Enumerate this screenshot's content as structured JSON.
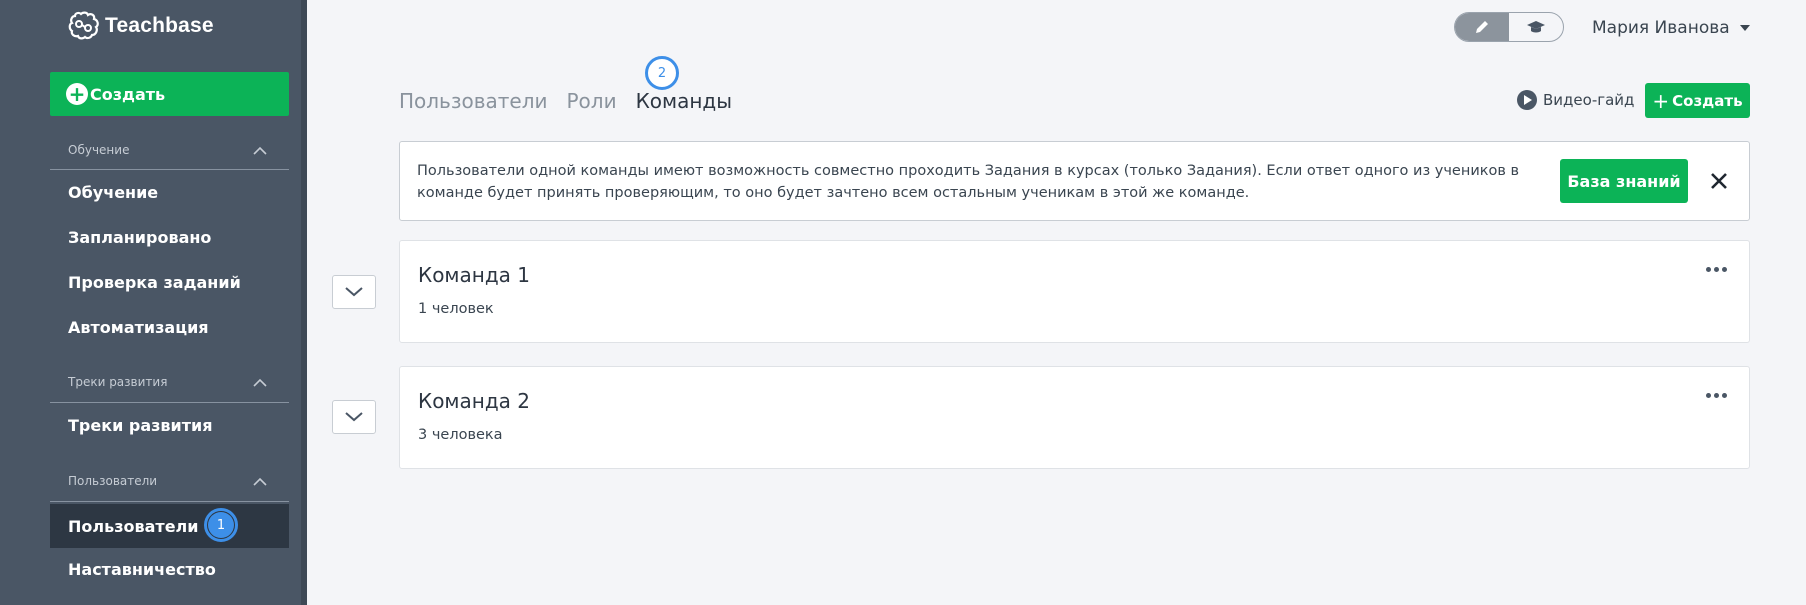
{
  "sidebar": {
    "logo_text": "Teachbase",
    "create_label": "Создать",
    "sections": [
      {
        "title": "Обучение",
        "items": [
          "Обучение",
          "Запланировано",
          "Проверка заданий",
          "Автоматизация"
        ]
      },
      {
        "title": "Треки развития",
        "items": [
          "Треки развития"
        ]
      },
      {
        "title": "Пользователи",
        "items": [
          "Пользователи",
          "Наставничество"
        ]
      }
    ],
    "active_item": "Пользователи",
    "badge_1": "1"
  },
  "header": {
    "user_name": "Мария Иванова"
  },
  "tabs": [
    "Пользователи",
    "Роли",
    "Команды"
  ],
  "active_tab": "Команды",
  "badge_2": "2",
  "toolbar": {
    "video_guide": "Видео-гайд",
    "create_label": "Создать"
  },
  "info": {
    "text": "Пользователи одной команды имеют возможность совместно проходить Задания в курсах (только Задания). Если ответ одного из учеников в команде будет принять проверяющим, то оно будет зачтено всем остальным ученикам в этой же команде.",
    "button": "База знаний"
  },
  "teams": [
    {
      "name": "Команда 1",
      "members": "1 человек"
    },
    {
      "name": "Команда 2",
      "members": "3 человека"
    }
  ],
  "colors": {
    "sidebar": "#4a5665",
    "accent_green": "#0cb357",
    "badge_blue": "#3d8fe8"
  },
  "icons": [
    "brain-logo-icon",
    "plus-circle-icon",
    "chevron-up-icon",
    "pencil-icon",
    "graduation-cap-icon",
    "caret-down-icon",
    "play-icon",
    "close-icon",
    "chevron-down-icon",
    "more-dots-icon"
  ]
}
